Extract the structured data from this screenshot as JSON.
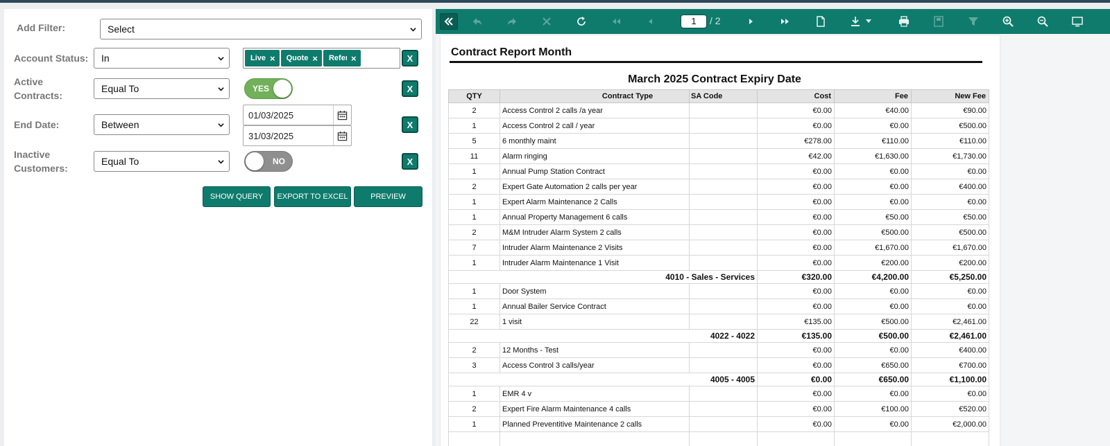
{
  "filters": {
    "add_filter_label": "Add Filter:",
    "add_filter_value": "Select",
    "account_status": {
      "label": "Account Status:",
      "operator": "In",
      "tags": [
        "Live",
        "Quote",
        "Referral"
      ],
      "remove_label": "X"
    },
    "active_contracts": {
      "label_line1": "Active",
      "label_line2": "Contracts:",
      "operator": "Equal To",
      "toggle_label": "YES",
      "remove_label": "X"
    },
    "end_date": {
      "label": "End Date:",
      "operator": "Between",
      "from": "01/03/2025",
      "to": "31/03/2025",
      "remove_label": "X"
    },
    "inactive_customers": {
      "label_line1": "Inactive",
      "label_line2": "Customers:",
      "operator": "Equal To",
      "toggle_label": "NO",
      "remove_label": "X"
    }
  },
  "actions": {
    "show_query": "SHOW QUERY",
    "export_excel": "EXPORT TO EXCEL",
    "preview": "PREVIEW"
  },
  "viewer": {
    "current_page": "1",
    "total_pages": "/ 2"
  },
  "report": {
    "title": "Contract Report Month",
    "subtitle": "March 2025 Contract Expiry Date",
    "columns": [
      "QTY",
      "Contract Type",
      "SA Code",
      "Cost",
      "Fee",
      "New Fee"
    ],
    "rows": [
      {
        "qty": "2",
        "type": "Access Control 2 calls /a year",
        "cost": "€0.00",
        "fee": "€40.00",
        "new_fee": "€90.00"
      },
      {
        "qty": "1",
        "type": "Access Control 2 call / year",
        "cost": "€0.00",
        "fee": "€0.00",
        "new_fee": "€500.00"
      },
      {
        "qty": "5",
        "type": "6 monthly maint",
        "cost": "€278.00",
        "fee": "€110.00",
        "new_fee": "€110.00"
      },
      {
        "qty": "11",
        "type": "Alarm ringing",
        "cost": "€42.00",
        "fee": "€1,630.00",
        "new_fee": "€1,730.00"
      },
      {
        "qty": "1",
        "type": "Annual Pump Station Contract",
        "cost": "€0.00",
        "fee": "€0.00",
        "new_fee": "€0.00"
      },
      {
        "qty": "2",
        "type": "Expert Gate Automation 2 calls per year",
        "cost": "€0.00",
        "fee": "€0.00",
        "new_fee": "€400.00"
      },
      {
        "qty": "1",
        "type": "Expert Alarm Maintenance 2 Calls",
        "cost": "€0.00",
        "fee": "€0.00",
        "new_fee": "€0.00"
      },
      {
        "qty": "1",
        "type": "Annual Property Management 6 calls",
        "cost": "€0.00",
        "fee": "€50.00",
        "new_fee": "€50.00"
      },
      {
        "qty": "2",
        "type": "M&M Intruder Alarm System 2 calls",
        "cost": "€0.00",
        "fee": "€500.00",
        "new_fee": "€500.00"
      },
      {
        "qty": "7",
        "type": "Intruder Alarm Maintenance 2 Visits",
        "cost": "€0.00",
        "fee": "€1,670.00",
        "new_fee": "€1,670.00"
      },
      {
        "qty": "1",
        "type": "Intruder Alarm Maintenance 1 Visit",
        "cost": "€0.00",
        "fee": "€200.00",
        "new_fee": "€200.00"
      },
      {
        "subtotal": true,
        "label": "4010 - Sales - Services",
        "cost": "€320.00",
        "fee": "€4,200.00",
        "new_fee": "€5,250.00"
      },
      {
        "qty": "1",
        "type": "Door System",
        "cost": "€0.00",
        "fee": "€0.00",
        "new_fee": "€0.00"
      },
      {
        "qty": "1",
        "type": "Annual Bailer Service Contract",
        "cost": "€0.00",
        "fee": "€0.00",
        "new_fee": "€0.00"
      },
      {
        "qty": "22",
        "type": " 1 visit",
        "cost": "€135.00",
        "fee": "€500.00",
        "new_fee": "€2,461.00"
      },
      {
        "subtotal": true,
        "label": "4022 - 4022",
        "cost": "€135.00",
        "fee": "€500.00",
        "new_fee": "€2,461.00"
      },
      {
        "qty": "2",
        "type": "12 Months - Test",
        "cost": "€0.00",
        "fee": "€0.00",
        "new_fee": "€400.00"
      },
      {
        "qty": "3",
        "type": "Access Control 3 calls/year",
        "cost": "€0.00",
        "fee": "€650.00",
        "new_fee": "€700.00"
      },
      {
        "subtotal": true,
        "label": "4005 - 4005",
        "cost": "€0.00",
        "fee": "€650.00",
        "new_fee": "€1,100.00"
      },
      {
        "qty": "1",
        "type": "EMR 4 v",
        "cost": "€0.00",
        "fee": "€0.00",
        "new_fee": "€0.00"
      },
      {
        "qty": "2",
        "type": "Expert Fire Alarm Maintenance 4 calls",
        "cost": "€0.00",
        "fee": "€100.00",
        "new_fee": "€520.00"
      },
      {
        "qty": "1",
        "type": "Planned Preventitive Maintenance 2 calls",
        "cost": "€0.00",
        "fee": "€0.00",
        "new_fee": "€2,000.00"
      },
      {
        "qty": "",
        "type": "",
        "cost": "",
        "fee": "",
        "new_fee": ""
      }
    ]
  }
}
